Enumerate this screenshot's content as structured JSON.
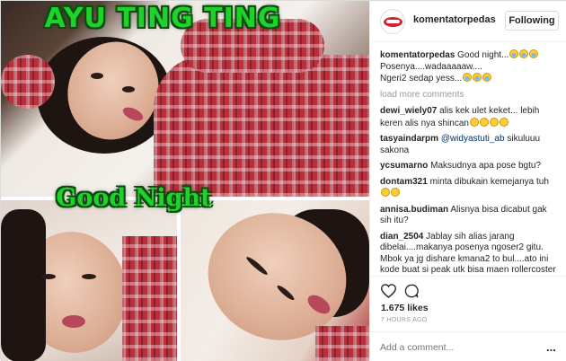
{
  "post": {
    "overlay_title": "AYU TING TING",
    "overlay_subtitle": "Good Night"
  },
  "header": {
    "username": "komentatorpedas",
    "follow_label": "Following"
  },
  "caption": {
    "username": "komentatorpedas",
    "text_line1": "Good night...",
    "text_line2": "Posenya....wadaaaaaw....",
    "text_line3": "Ngeri2 sedap yess..."
  },
  "load_more_label": "load more comments",
  "comments": [
    {
      "username": "dewi_wiely07",
      "text": "alis kek ulet keket... lebih keren alis nya shincan"
    },
    {
      "username": "tasyaindarpm",
      "mention": "@widyastuti_ab",
      "text": "sikuluuu sakona"
    },
    {
      "username": "ycsumarno",
      "text": "Maksudnya apa pose bgtu?"
    },
    {
      "username": "dontam321",
      "text": "minta dibukain kemejanya tuh"
    },
    {
      "username": "annisa.budiman",
      "text": "Alisnya bisa dicabut gak sih itu?"
    },
    {
      "username": "dian_2504",
      "text": "Jablay sih alias jarang dibelai....makanya posenya ngoser2 gitu. Mbok ya jg dishare kmana2 to bul....ato ini kode buat si peak utk bisa maen rollercoster gitu."
    }
  ],
  "likes_text": "1.675 likes",
  "time_text": "7 HOURS AGO",
  "add_comment_placeholder": "Add a comment...",
  "more_options_label": "...",
  "icons": {
    "heart": "heart-icon",
    "comment": "comment-bubble-icon",
    "avatar": "lips-logo-icon",
    "emoji": "crying-laughing-emoji"
  },
  "colors": {
    "overlay_text": "#1ed22a",
    "overlay_outline": "#0c4a10",
    "mention": "#003569",
    "muted": "#999999"
  }
}
